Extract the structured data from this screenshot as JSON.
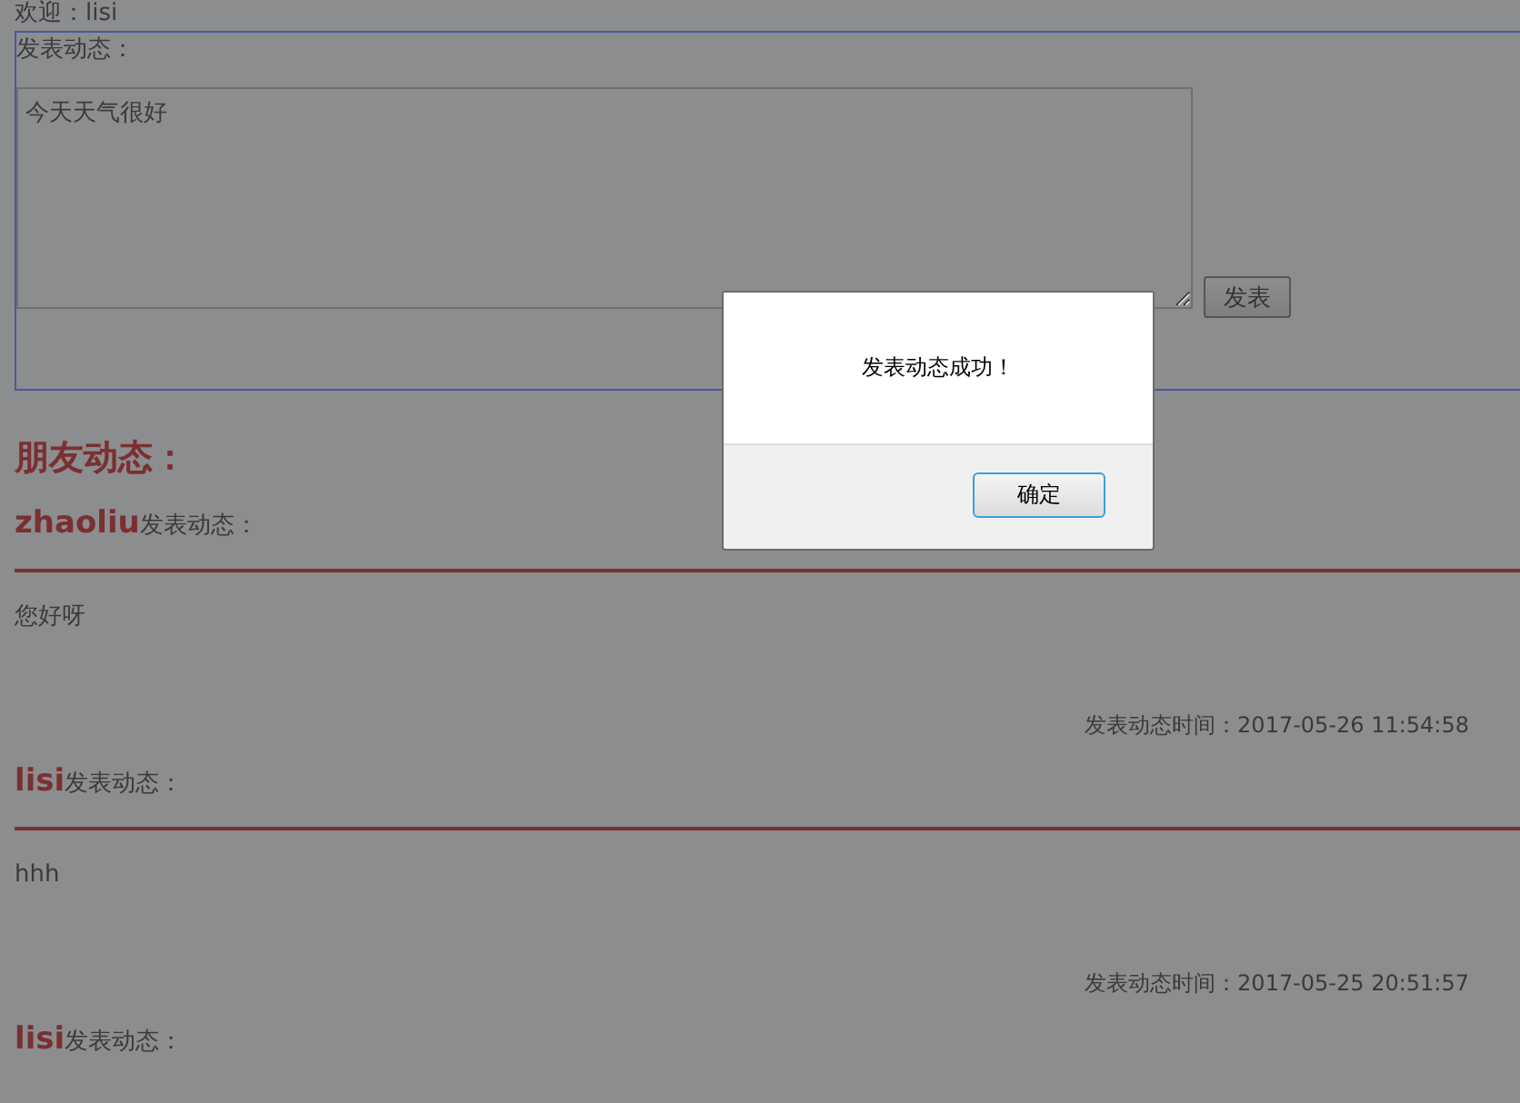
{
  "welcome": "欢迎：lisi",
  "compose": {
    "label": "发表动态：",
    "value": "今天天气很好",
    "button": "发表"
  },
  "feed_title": "朋友动态：",
  "posts": [
    {
      "author": "zhaoliu",
      "action": "发表动态：",
      "content": "您好呀",
      "time": "发表动态时间：2017-05-26 11:54:58"
    },
    {
      "author": "lisi",
      "action": "发表动态：",
      "content": "hhh",
      "time": "发表动态时间：2017-05-25 20:51:57"
    },
    {
      "author": "lisi",
      "action": "发表动态："
    }
  ],
  "dialog": {
    "message": "发表动态成功！",
    "button": "确定"
  }
}
